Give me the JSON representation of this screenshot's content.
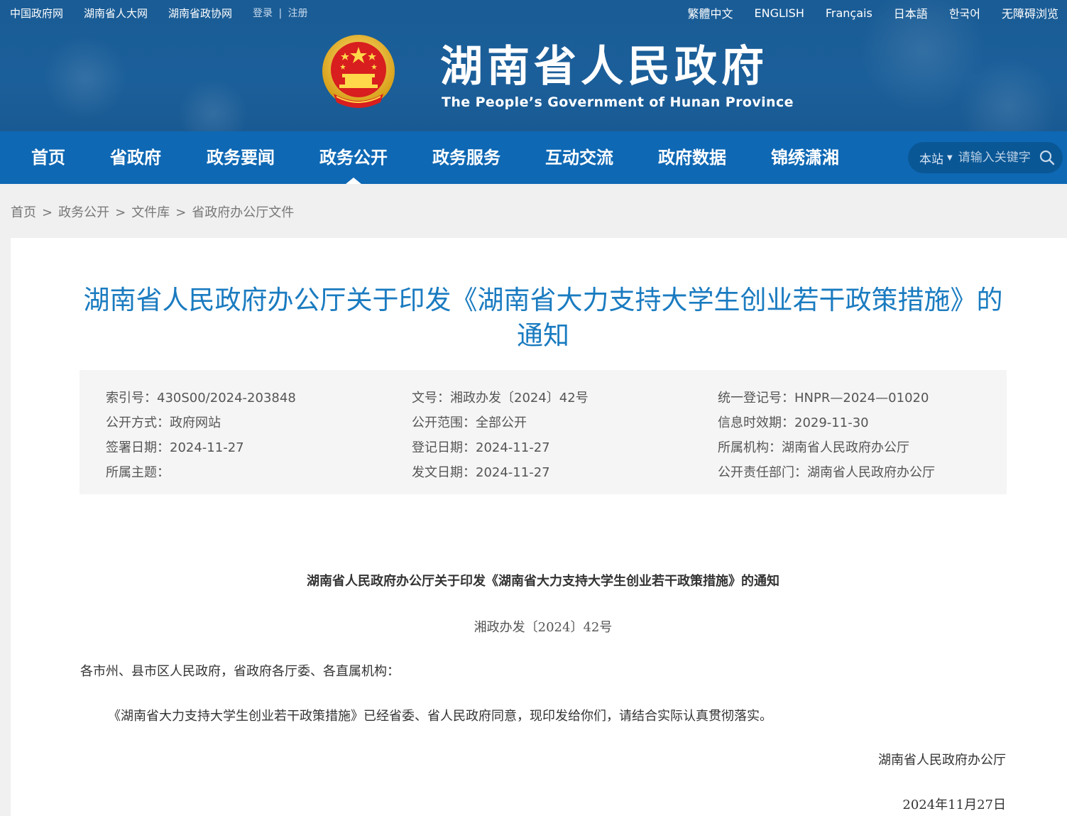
{
  "header": {
    "top_links": [
      "中国政府网",
      "湖南省人大网",
      "湖南省政协网"
    ],
    "login": "登录",
    "divider": "|",
    "register": "注册",
    "languages": [
      "繁體中文",
      "ENGLISH",
      "Français",
      "日本語",
      "한국어",
      "无障碍浏览"
    ],
    "site_title": "湖南省人民政府",
    "site_subtitle": "The People’s Government of Hunan Province"
  },
  "nav": {
    "items": [
      "首页",
      "省政府",
      "政务要闻",
      "政务公开",
      "政务服务",
      "互动交流",
      "政府数据",
      "锦绣潇湘"
    ],
    "active_index": 3,
    "search_scope": "本站",
    "search_placeholder": "请输入关键字"
  },
  "breadcrumb": {
    "items": [
      "首页",
      "政务公开",
      "文件库",
      "省政府办公厅文件"
    ],
    "separator": ">"
  },
  "document": {
    "title_line1": "湖南省人民政府办公厅关于印发《湖南省大力支持大学生创业若干政策措施》的",
    "title_line2": "通知",
    "meta": {
      "index_no": "索引号：430S00/2024-203848",
      "doc_no": "文号：湘政办发〔2024〕42号",
      "reg_no": "统一登记号：HNPR—2024—01020",
      "open_mode": "公开方式：政府网站",
      "open_scope": "公开范围：全部公开",
      "valid_until": "信息时效期：2029-11-30",
      "sign_date": "签署日期：2024-11-27",
      "reg_date": "登记日期：2024-11-27",
      "org": "所属机构：湖南省人民政府办公厅",
      "topic": "所属主题：",
      "issue_date": "发文日期：2024-11-27",
      "dept": "公开责任部门：湖南省人民政府办公厅"
    },
    "body_title": "湖南省人民政府办公厅关于印发《湖南省大力支持大学生创业若干政策措施》的通知",
    "body_docno": "湘政办发〔2024〕42号",
    "recipients": "各市州、县市区人民政府，省政府各厅委、各直属机构：",
    "content": "《湖南省大力支持大学生创业若干政策措施》已经省委、省人民政府同意，现印发给你们，请结合实际认真贯彻落实。",
    "signer": "湖南省人民政府办公厅",
    "date": "2024年11月27日"
  },
  "colors": {
    "header_bg": "#1b5f9a",
    "nav_bg": "#0e68b4",
    "title_blue": "#1a7bc0",
    "meta_bg": "#f5f5f5"
  },
  "icons": [
    "national-emblem-icon",
    "search-icon",
    "caret-down-icon"
  ]
}
